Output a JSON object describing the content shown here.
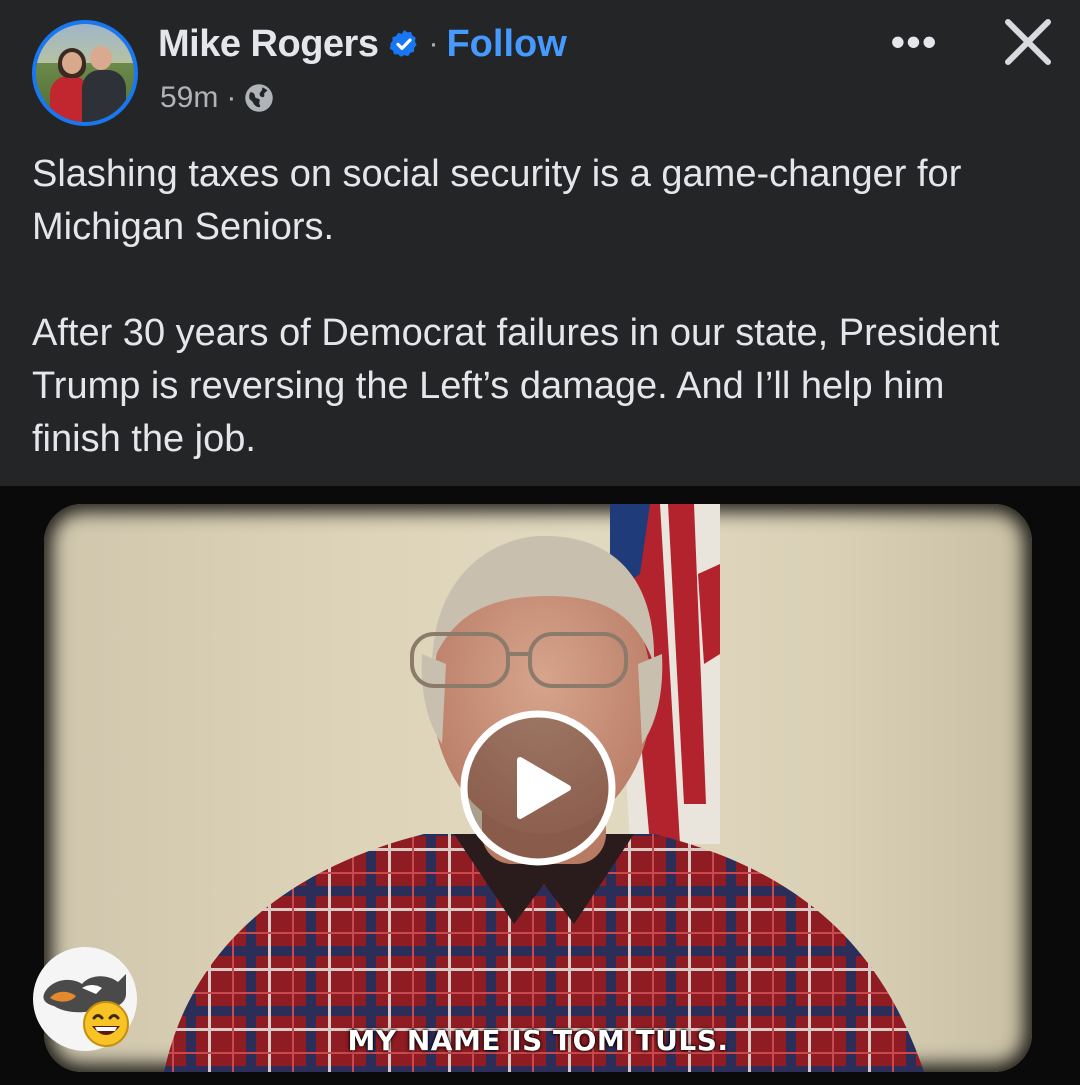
{
  "author": {
    "name": "Mike Rogers",
    "verified_icon": "verified-badge-icon",
    "follow_label": "Follow",
    "dot": "·"
  },
  "meta": {
    "time": "59m",
    "dot": "·",
    "audience_icon": "globe-icon"
  },
  "header_actions": {
    "more_label": "•••",
    "close_icon": "close-icon"
  },
  "post": {
    "paragraph_1": "Slashing taxes on social security is a game-changer for Michigan Seniors.",
    "paragraph_2": "After 30 years of Democrat failures in our state, President Trump is reversing the Left’s damage. And I’ll help him finish the job."
  },
  "video": {
    "caption": "MY NAME IS TOM TULS.",
    "play_icon": "play-icon"
  },
  "colors": {
    "background": "#242526",
    "text_primary": "#e4e6eb",
    "text_secondary": "#b0b3b8",
    "link": "#4599ff",
    "verified": "#1877f2"
  }
}
